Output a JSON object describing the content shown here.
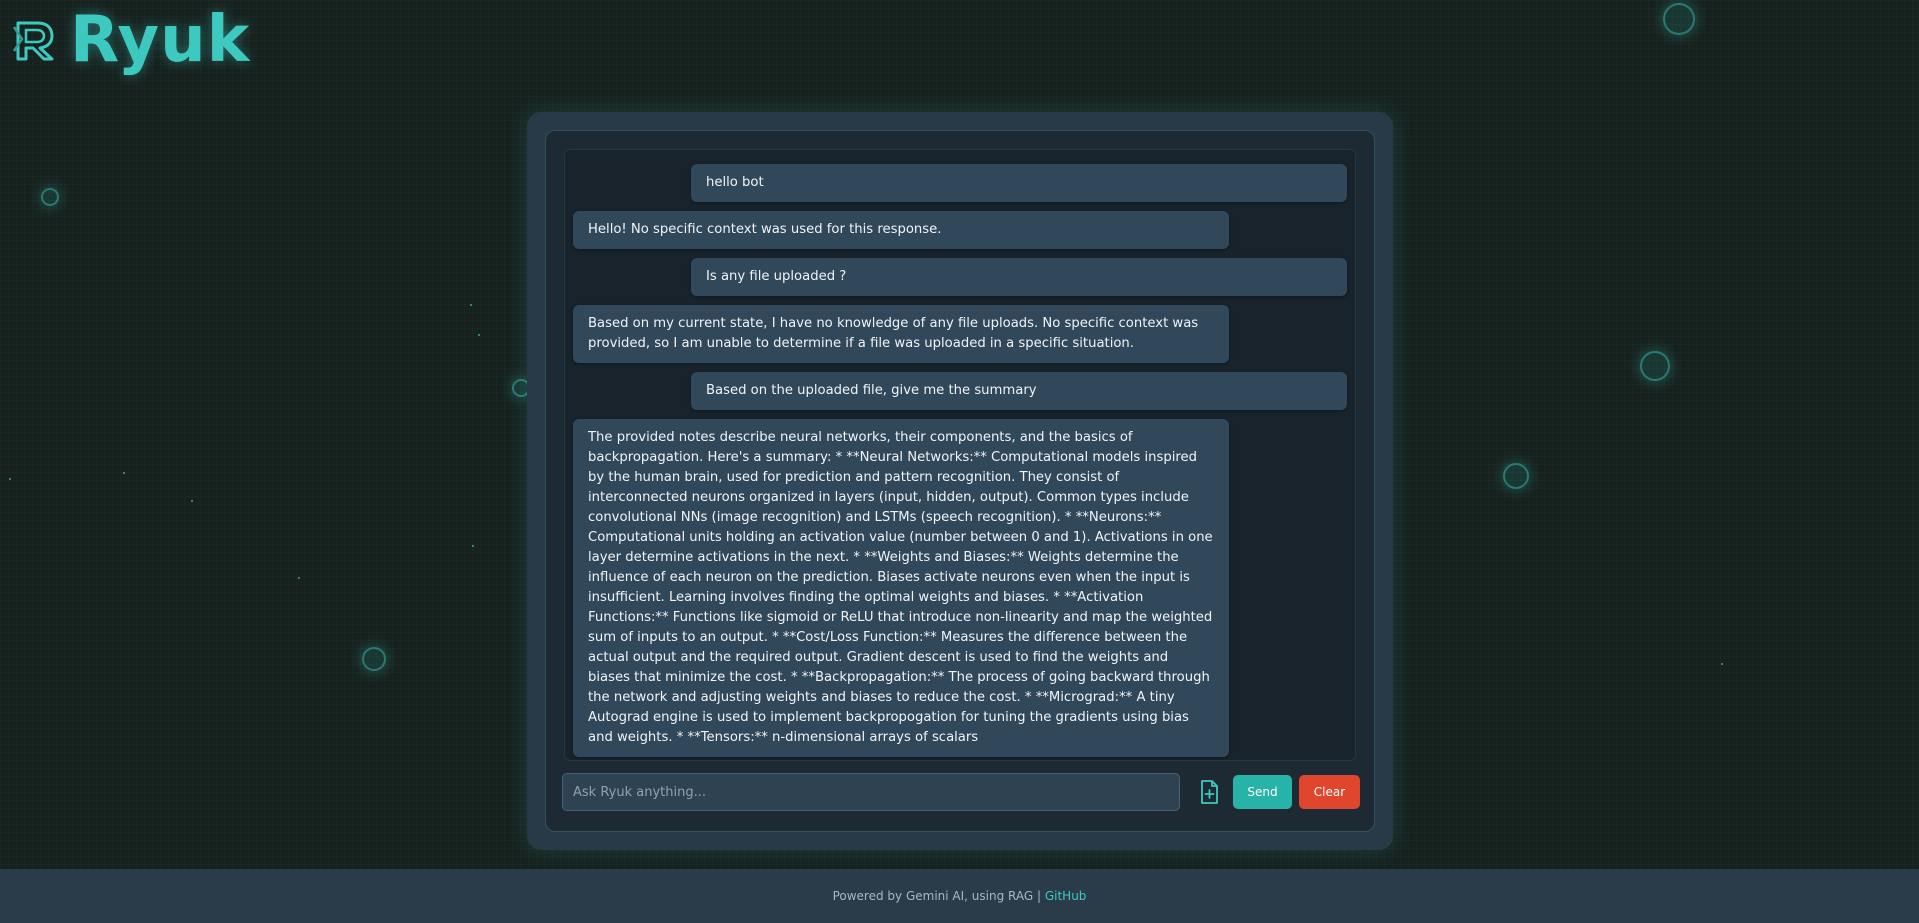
{
  "app": {
    "name": "Ryuk",
    "accent_color": "#3ec9c0",
    "logo_icon": "r-logo-icon"
  },
  "chat": {
    "messages": [
      {
        "role": "user",
        "text": "hello bot"
      },
      {
        "role": "bot",
        "text": "Hello! No specific context was used for this response."
      },
      {
        "role": "user",
        "text": "Is any file uploaded ?"
      },
      {
        "role": "bot",
        "text": "Based on my current state, I have no knowledge of any file uploads. No specific context was provided, so I am unable to determine if a file was uploaded in a specific situation."
      },
      {
        "role": "user",
        "text": "Based on the uploaded file, give me the summary"
      },
      {
        "role": "bot",
        "text": "The provided notes describe neural networks, their components, and the basics of backpropagation. Here's a summary: * **Neural Networks:** Computational models inspired by the human brain, used for prediction and pattern recognition. They consist of interconnected neurons organized in layers (input, hidden, output). Common types include convolutional NNs (image recognition) and LSTMs (speech recognition). * **Neurons:** Computational units holding an activation value (number between 0 and 1). Activations in one layer determine activations in the next. * **Weights and Biases:** Weights determine the influence of each neuron on the prediction. Biases activate neurons even when the input is insufficient. Learning involves finding the optimal weights and biases. * **Activation Functions:** Functions like sigmoid or ReLU that introduce non-linearity and map the weighted sum of inputs to an output. * **Cost/Loss Function:** Measures the difference between the actual output and the required output. Gradient descent is used to find the weights and biases that minimize the cost. * **Backpropagation:** The process of going backward through the network and adjusting weights and biases to reduce the cost. * **Micrograd:** A tiny Autograd engine is used to implement backpropogation for tuning the gradients using bias and weights. * **Tensors:** n-dimensional arrays of scalars"
      }
    ],
    "user_bubble_color": "#31475a",
    "bot_bubble_color": "#31475a"
  },
  "composer": {
    "placeholder": "Ask Ryuk anything...",
    "value": "",
    "upload_icon": "file-upload-icon",
    "send_label": "Send",
    "send_color": "#27b3a8",
    "clear_label": "Clear",
    "clear_color": "#e0462d"
  },
  "footer": {
    "text": "Powered by Gemini AI, using RAG | ",
    "link_label": "GitHub"
  }
}
